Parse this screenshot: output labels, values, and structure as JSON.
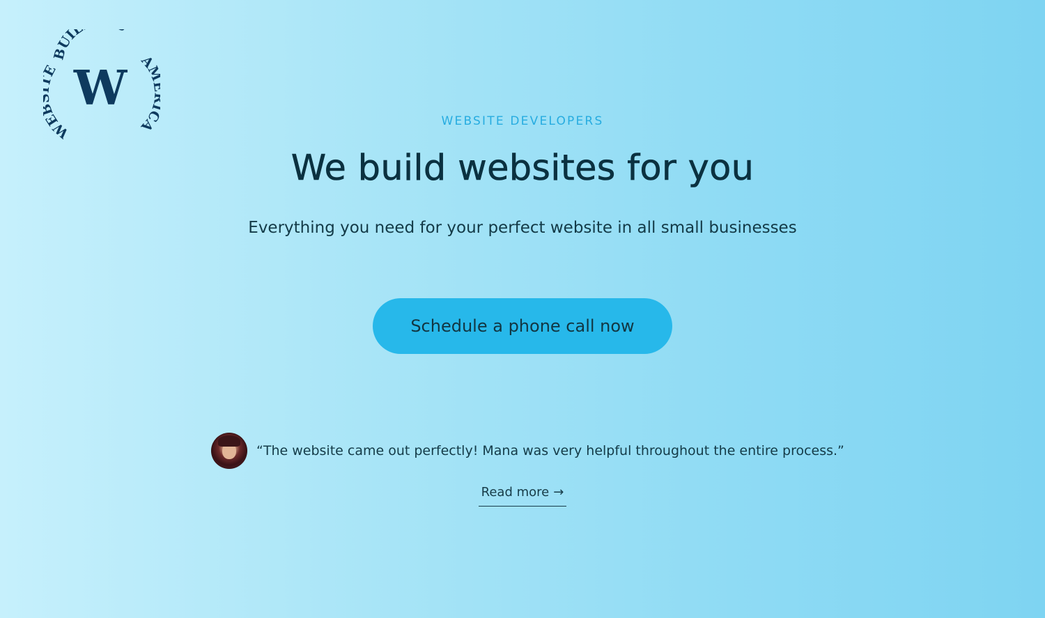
{
  "logo": {
    "top_arc_text": "BUILDERS",
    "left_arc_text": "WEBSITE",
    "right_arc_text": "AMERICA",
    "letter": "W",
    "color": "#0e3a5e"
  },
  "hero": {
    "eyebrow": "WEBSITE DEVELOPERS",
    "headline": "We build websites for you",
    "subheadline": "Everything you need for your perfect website in all small businesses",
    "cta_label": "Schedule a phone call now",
    "cta_color": "#27b8ea",
    "eyebrow_color": "#27ace0"
  },
  "testimonial": {
    "avatar_icon": "user-avatar-photo",
    "quote": "“The website came out perfectly! Mana was very helpful throughout the entire process.”",
    "read_more_label": "Read more",
    "read_more_arrow": "→"
  },
  "background": {
    "gradient_from": "#c6f0fc",
    "gradient_to": "#7ed4f2"
  }
}
